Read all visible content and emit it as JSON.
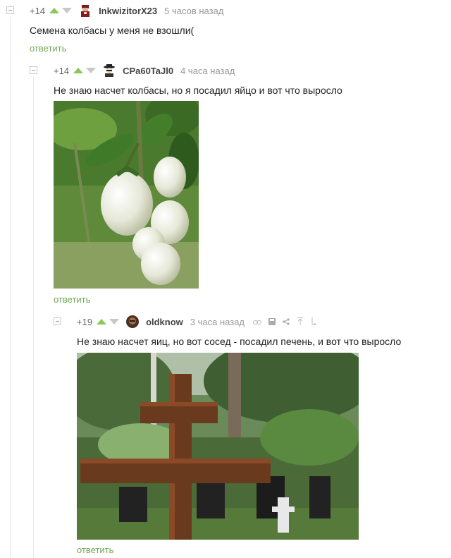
{
  "comments": [
    {
      "rating": "+14",
      "user": "InkwizitorX23",
      "time": "5 часов назад",
      "text": "Семена колбасы у меня не взошли(",
      "reply": "ответить"
    },
    {
      "rating": "+14",
      "user": "CPa60TaJl0",
      "time": "4 часа назад",
      "text": "Не знаю насчет колбасы, но я посадил яйцо и вот что выросло",
      "reply": "ответить"
    },
    {
      "rating": "+19",
      "user": "oldknow",
      "time": "3 часа назад",
      "text": "Не знаю насчет яиц, но вот сосед - посадил печень, и вот что выросло",
      "reply": "ответить",
      "tools": [
        "link-icon",
        "save-icon",
        "share-icon",
        "scroll-top-icon",
        "parent-icon"
      ]
    }
  ],
  "colors": {
    "accent_green": "#6fa854",
    "upvote": "#8ac858",
    "downvote": "#c8c8c8"
  }
}
